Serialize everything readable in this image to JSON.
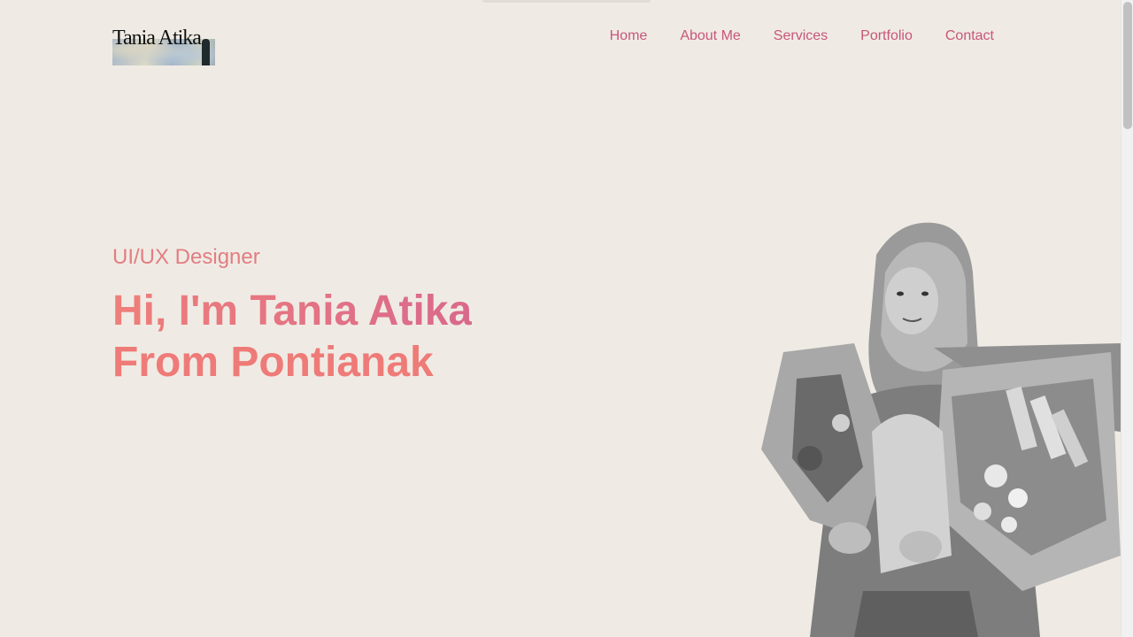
{
  "logo": {
    "text": "Tania Atika"
  },
  "nav": {
    "items": [
      {
        "label": "Home"
      },
      {
        "label": "About Me"
      },
      {
        "label": "Services"
      },
      {
        "label": "Portfolio"
      },
      {
        "label": "Contact"
      }
    ]
  },
  "hero": {
    "subtitle": "UI/UX Designer",
    "headline_line1": "Hi, I'm Tania Atika",
    "headline_line2": "From Pontianak"
  },
  "colors": {
    "background": "#efebe4",
    "nav_link": "#c9557a",
    "accent_coral": "#ee7b78",
    "accent_pink": "#d9698c"
  }
}
